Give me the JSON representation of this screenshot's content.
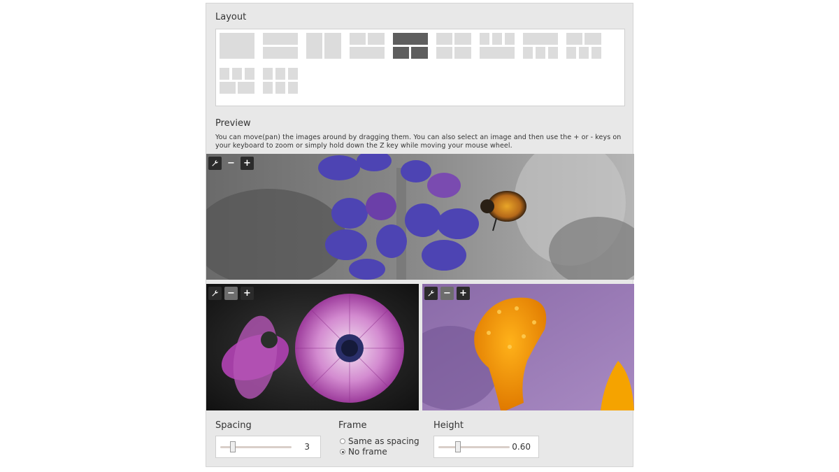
{
  "layout_section": {
    "title": "Layout",
    "options": [
      {
        "id": "single"
      },
      {
        "id": "two-rows"
      },
      {
        "id": "two-cols"
      },
      {
        "id": "two-top-one-bottom"
      },
      {
        "id": "one-top-two-bottom",
        "selected": true
      },
      {
        "id": "grid-2x2"
      },
      {
        "id": "three-top-one-bottom"
      },
      {
        "id": "one-top-three-bottom"
      },
      {
        "id": "two-top-three-bottom"
      },
      {
        "id": "three-top-two-bottom"
      },
      {
        "id": "grid-3x2"
      }
    ]
  },
  "preview_section": {
    "title": "Preview",
    "help_text": "You can move(pan) the images around by dragging them. You can also select an image and then use the + or - keys on your keyboard to zoom or simply hold down the Z key while moving your mouse wheel.",
    "images": [
      {
        "subject": "lupine flower with bumblebee"
      },
      {
        "subject": "purple daisies"
      },
      {
        "subject": "orange crocus stamen"
      }
    ],
    "tool_icons": {
      "settings": "wrench-icon",
      "zoom_out": "−",
      "zoom_in": "+"
    }
  },
  "controls": {
    "spacing": {
      "label": "Spacing",
      "value": "3"
    },
    "frame": {
      "label": "Frame",
      "options": [
        {
          "label": "Same as spacing",
          "checked": false
        },
        {
          "label": "No frame",
          "checked": true
        }
      ]
    },
    "height": {
      "label": "Height",
      "value": "0.60"
    }
  },
  "colors": {
    "selected_layout": "#5e5e5e",
    "unselected_layout": "#dcdcdc",
    "panel_bg": "#e8e8e8"
  }
}
